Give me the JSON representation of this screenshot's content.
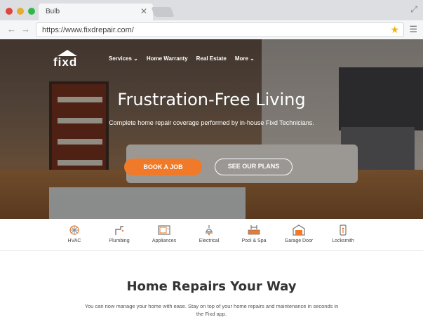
{
  "browser": {
    "tab_title": "Bulb",
    "url": "https://www.fixdrepair.com/",
    "traffic_lights": [
      "#e0443e",
      "#e6ac2e",
      "#2fb74a"
    ]
  },
  "site": {
    "logo": "fixd",
    "nav": [
      "Services ⌄",
      "Home Warranty",
      "Real Estate",
      "More ⌄"
    ]
  },
  "hero": {
    "title": "Frustration-Free Living",
    "subtitle": "Complete home repair coverage performed by in-house Fixd Technicians.",
    "book_label": "BOOK A JOB",
    "plans_label": "SEE OUR PLANS",
    "accent": "#f07a2a"
  },
  "services": [
    {
      "label": "HVAC",
      "icon": "hvac-icon"
    },
    {
      "label": "Plumbing",
      "icon": "plumbing-icon"
    },
    {
      "label": "Appliances",
      "icon": "appliances-icon"
    },
    {
      "label": "Electrical",
      "icon": "electrical-icon"
    },
    {
      "label": "Pool & Spa",
      "icon": "pool-spa-icon"
    },
    {
      "label": "Garage Door",
      "icon": "garage-door-icon"
    },
    {
      "label": "Locksmith",
      "icon": "locksmith-icon"
    }
  ],
  "content": {
    "title": "Home Repairs Your Way",
    "description": "You can now manage your home with ease. Stay on top of your home repairs and maintenance in seconds in the Fixd app."
  }
}
